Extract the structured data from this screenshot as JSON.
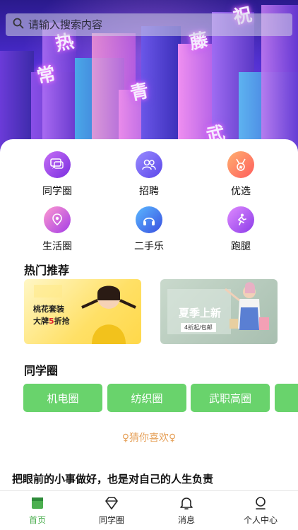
{
  "search": {
    "placeholder": "请输入搜索内容",
    "icon": "search-icon"
  },
  "hero": {
    "decorative_chars": [
      "祝",
      "热",
      "藤",
      "青",
      "常",
      "武"
    ]
  },
  "categories": [
    {
      "label": "同学圈",
      "icon": "chat-bubbles-icon",
      "color": "#8a3be8"
    },
    {
      "label": "招聘",
      "icon": "people-icon",
      "color": "#6c56f2"
    },
    {
      "label": "优选",
      "icon": "medal-icon",
      "color": "#ff7a4a"
    },
    {
      "label": "生活圈",
      "icon": "location-pin-icon",
      "color": "#c43fe0"
    },
    {
      "label": "二手乐",
      "icon": "headphones-icon",
      "color": "#3b63e0"
    },
    {
      "label": "跑腿",
      "icon": "runner-icon",
      "color": "#b64cf0"
    }
  ],
  "hot": {
    "title": "热门推荐",
    "banner1": {
      "line1": "桃花套装",
      "line2_prefix": "大牌",
      "line2_number": "5",
      "line2_suffix": "折抢"
    },
    "banner2": {
      "big": "夏季上新",
      "small": "4折起/包邮"
    }
  },
  "circles": {
    "title": "同学圈",
    "chips": [
      "机电圈",
      "纺织圈",
      "武职高圈",
      ""
    ]
  },
  "guess": "♀猜你喜欢♀",
  "motto": "把眼前的小事做好，也是对自己的人生负责",
  "tabs": [
    {
      "label": "首页",
      "icon": "home-icon",
      "active": true
    },
    {
      "label": "同学圈",
      "icon": "diamond-icon",
      "active": false
    },
    {
      "label": "消息",
      "icon": "bell-icon",
      "active": false
    },
    {
      "label": "个人中心",
      "icon": "person-icon",
      "active": false
    }
  ],
  "colors": {
    "accent_green": "#69d36c",
    "tab_active": "#4caf50",
    "guess_text": "#e6a15a",
    "price_red": "#e0262d"
  }
}
